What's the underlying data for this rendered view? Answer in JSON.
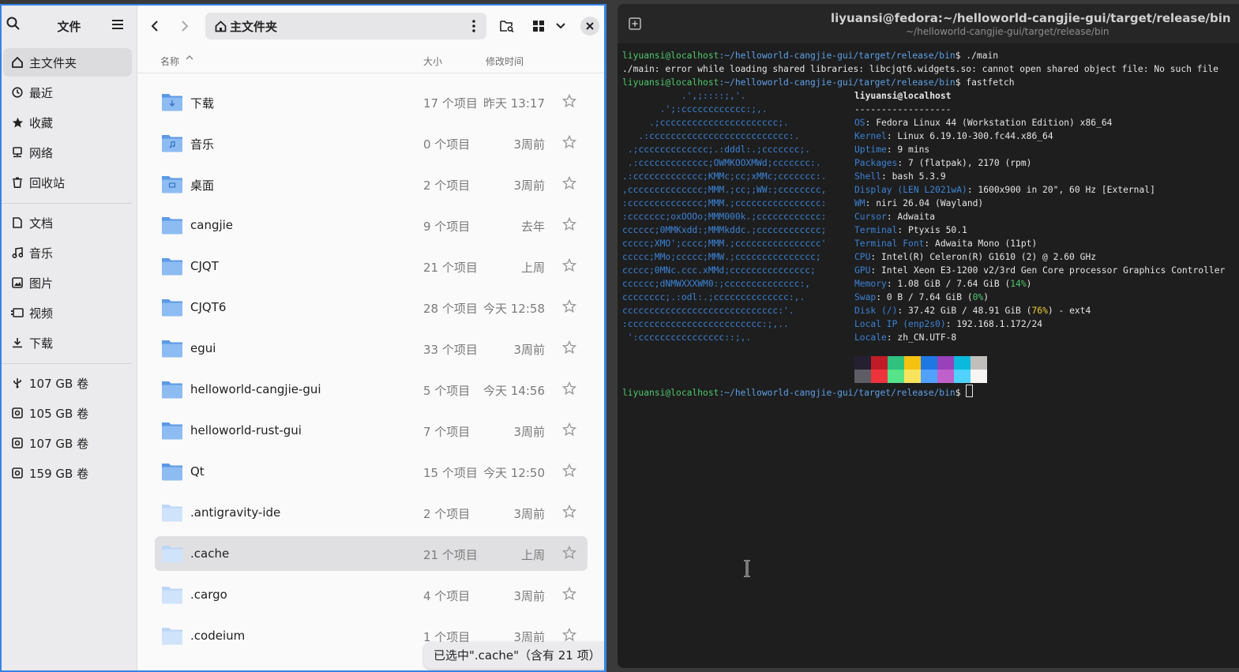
{
  "files_app": {
    "title": "文件",
    "path_label": "主文件夹",
    "sidebar": {
      "places": [
        {
          "label": "主文件夹",
          "icon": "home-icon"
        },
        {
          "label": "最近",
          "icon": "clock-icon"
        },
        {
          "label": "收藏",
          "icon": "star-icon"
        },
        {
          "label": "网络",
          "icon": "network-icon"
        },
        {
          "label": "回收站",
          "icon": "trash-icon"
        }
      ],
      "bookmarks": [
        {
          "label": "文档",
          "icon": "document-icon"
        },
        {
          "label": "音乐",
          "icon": "music-icon"
        },
        {
          "label": "图片",
          "icon": "image-icon"
        },
        {
          "label": "视频",
          "icon": "video-icon"
        },
        {
          "label": "下载",
          "icon": "download-icon"
        }
      ],
      "volumes": [
        {
          "label": "107 GB 卷",
          "icon": "usb-icon"
        },
        {
          "label": "105 GB 卷",
          "icon": "drive-icon"
        },
        {
          "label": "107 GB 卷",
          "icon": "drive-icon"
        },
        {
          "label": "159 GB 卷",
          "icon": "drive-icon"
        }
      ]
    },
    "columns": {
      "name": "名称",
      "size": "大小",
      "modified": "修改时间"
    },
    "rows": [
      {
        "name": "下载",
        "size": "17 个项目",
        "modified": "昨天 13:17"
      },
      {
        "name": "音乐",
        "size": "0 个项目",
        "modified": "3周前"
      },
      {
        "name": "桌面",
        "size": "2 个项目",
        "modified": "3周前"
      },
      {
        "name": "cangjie",
        "size": "9 个项目",
        "modified": "去年"
      },
      {
        "name": "CJQT",
        "size": "21 个项目",
        "modified": "上周"
      },
      {
        "name": "CJQT6",
        "size": "28 个项目",
        "modified": "今天 12:58"
      },
      {
        "name": "egui",
        "size": "33 个项目",
        "modified": "3周前"
      },
      {
        "name": "helloworld-cangjie-gui",
        "size": "5 个项目",
        "modified": "今天 14:56"
      },
      {
        "name": "helloworld-rust-gui",
        "size": "7 个项目",
        "modified": "3周前"
      },
      {
        "name": "Qt",
        "size": "15 个项目",
        "modified": "今天 12:50"
      },
      {
        "name": ".antigravity-ide",
        "size": "2 个项目",
        "modified": "3周前"
      },
      {
        "name": ".cache",
        "size": "21 个项目",
        "modified": "上周"
      },
      {
        "name": ".cargo",
        "size": "4 个项目",
        "modified": "3周前"
      },
      {
        "name": ".codeium",
        "size": "1 个项目",
        "modified": "3周前"
      }
    ],
    "status_toast": "已选中\".cache\"（含有 21 项）"
  },
  "terminal": {
    "title": "liyuansi@fedora:~/helloworld-cangjie-gui/target/release/bin",
    "subtitle": "~/helloworld-cangjie-gui/target/release/bin",
    "prompt_user": "liyuansi@localhost",
    "prompt_path": ":~/helloworld-cangjie-gui/target/release/bin",
    "cmd1": "$ ./main",
    "error_line": "./main: error while loading shared libraries: libcjqt6.widgets.so: cannot open shared object file: No such file",
    "cmd2": "$ fastfetch",
    "cmd3": "$ ",
    "logo": [
      "           .',;::::;,'.",
      "       .';:cccccccccccc:;,.",
      "     .;cccccccccccccccccccccc;.",
      "   .:cccccccccccccccccccccccccc:.",
      " .;ccccccccccccc;.:dddl:.;ccccccc;.",
      " .:ccccccccccccc;OWMKOOXMWd;ccccccc:.",
      ".:ccccccccccccc;KMMc;cc;xMMc;ccccccc:.",
      ",cccccccccccccc;MMM.;cc;;WW:;cccccccc,",
      ":cccccccccccccc;MMM.;cccccccccccccccc:",
      ":ccccccc;oxOOOo;MMM000k.;cccccccccccc:",
      "cccccc;0MMKxdd:;MMMkddc.;cccccccccccc;",
      "ccccc;XMO';cccc;MMM.;cccccccccccccccc'",
      "ccccc;MMo;ccccc;MMW.;ccccccccccccccc;",
      "ccccc;0MNc.ccc.xMMd;ccccccccccccccc;",
      "cccccc;dNMWXXXWM0:;cccccccccccccc:,",
      "cccccccc;.:odl:.;cccccccccccccc:,.",
      "ccccccccccccccccccccccccccccc:'.",
      ":ccccccccccccccccccccccccc:;,..",
      " ':cccccccccccccccc::;,."
    ],
    "host": "liyuansi@localhost",
    "separator": "------------------",
    "info": [
      {
        "key": "OS",
        "value": ": Fedora Linux 44 (Workstation Edition) x86_64"
      },
      {
        "key": "Kernel",
        "value": ": Linux 6.19.10-300.fc44.x86_64"
      },
      {
        "key": "Uptime",
        "value": ": 9 mins"
      },
      {
        "key": "Packages",
        "value": ": 7 (flatpak), 2170 (rpm)"
      },
      {
        "key": "Shell",
        "value": ": bash 5.3.9"
      },
      {
        "key": "Display (LEN L2021wA)",
        "value": ": 1600x900 in 20\", 60 Hz [External]"
      },
      {
        "key": "WM",
        "value": ": niri 26.04 (Wayland)"
      },
      {
        "key": "Cursor",
        "value": ": Adwaita"
      },
      {
        "key": "Terminal",
        "value": ": Ptyxis 50.1"
      },
      {
        "key": "Terminal Font",
        "value": ": Adwaita Mono (11pt)"
      },
      {
        "key": "CPU",
        "value": ": Intel(R) Celeron(R) G1610 (2) @ 2.60 GHz"
      },
      {
        "key": "GPU",
        "value": ": Intel Xeon E3-1200 v2/3rd Gen Core processor Graphics Controller"
      }
    ],
    "memory": {
      "key": "Memory",
      "value": ": 1.08 GiB / 7.64 GiB (",
      "pct": "14%",
      "end": ")"
    },
    "swap": {
      "key": "Swap",
      "value": ": 0 B / 7.64 GiB (",
      "pct": "0%",
      "end": ")"
    },
    "disk": {
      "key": "Disk (/)",
      "value": ": 37.42 GiB / 48.91 GiB (",
      "pct": "76%",
      "end": ") - ext4"
    },
    "localip": {
      "key": "Local IP (enp2s0)",
      "value": ": 192.168.1.172/24"
    },
    "locale": {
      "key": "Locale",
      "value": ": zh_CN.UTF-8"
    },
    "palette_top": [
      "#241f31",
      "#c01c28",
      "#2ec27e",
      "#f5c211",
      "#1e78e4",
      "#9841bb",
      "#0ab9dc",
      "#c0bfbc"
    ],
    "palette_bottom": [
      "#5e5c64",
      "#ed333b",
      "#57e389",
      "#f8e45c",
      "#51a1ff",
      "#c061cb",
      "#4fd2fd",
      "#f6f5f4"
    ]
  }
}
